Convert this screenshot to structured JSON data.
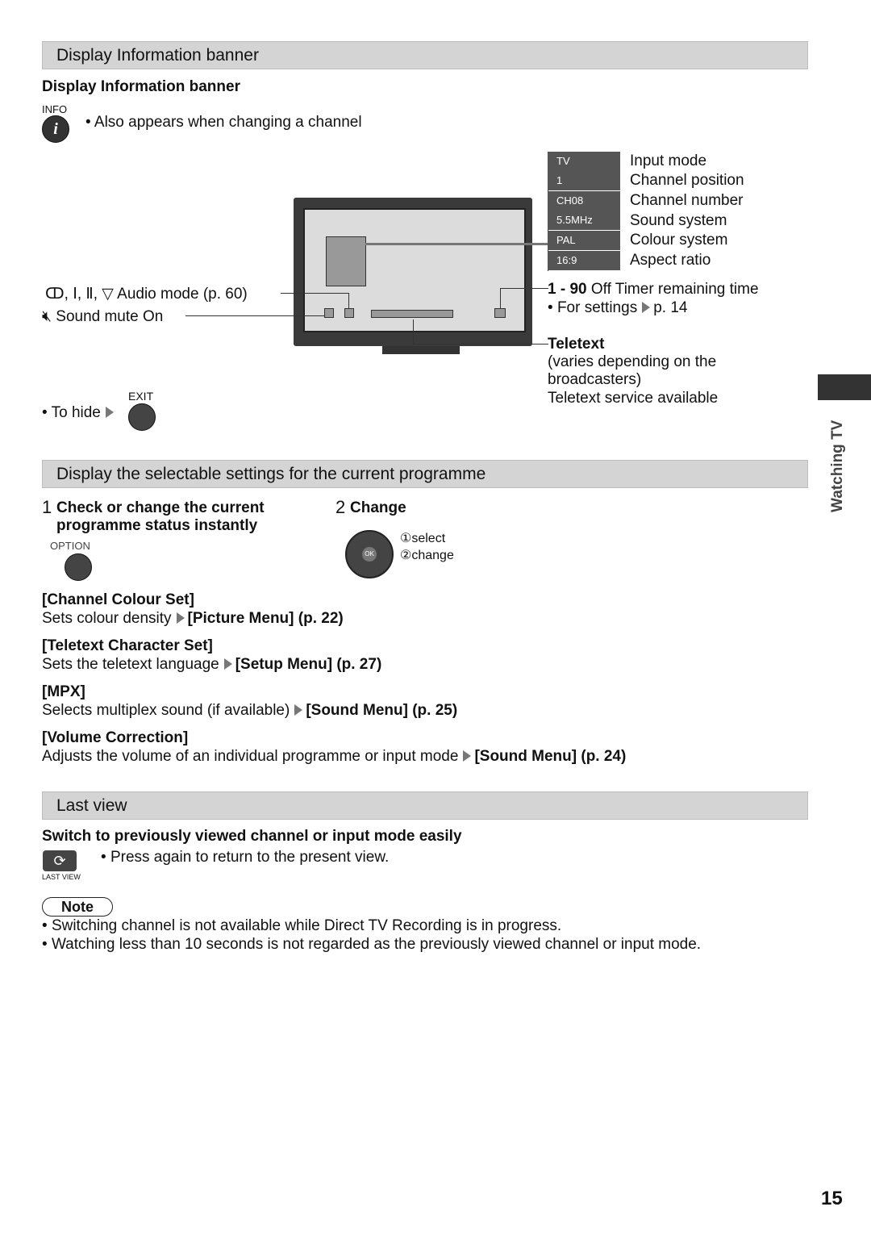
{
  "section1": {
    "title": "Display Information banner",
    "subtitle": "Display Information banner",
    "info_label": "INFO",
    "info_note": "Also appears when changing a channel",
    "osd": [
      {
        "code": "TV",
        "label": "Input mode"
      },
      {
        "code": "1",
        "label": "Channel position"
      },
      {
        "code": "CH08",
        "label": "Channel number"
      },
      {
        "code": "5.5MHz",
        "label": "Sound system"
      },
      {
        "code": "PAL",
        "label": "Colour system"
      },
      {
        "code": "16:9",
        "label": "Aspect ratio"
      }
    ],
    "audio_mode": "Audio mode (p. 60)",
    "audio_symbols": "ↀ, Ⅰ, Ⅱ, ▽",
    "sound_mute": "Sound mute On",
    "timer_range": "1 - 90",
    "timer_label": "Off Timer remaining time",
    "timer_settings": "For settings",
    "timer_page": "p. 14",
    "teletext_title": "Teletext",
    "teletext_line1": "(varies depending on the",
    "teletext_line2": "broadcasters)",
    "teletext_line3": "Teletext service available",
    "exit_label": "EXIT",
    "to_hide": "To hide"
  },
  "side_tab": "Watching TV",
  "section2": {
    "title": "Display the selectable settings for the current programme",
    "step1_num": "1",
    "step1_line1": "Check or change the current",
    "step1_line2": "programme status instantly",
    "option_label": "OPTION",
    "step2_num": "2",
    "step2": "Change",
    "ok_label": "OK",
    "select": "①select",
    "change": "②change",
    "items": [
      {
        "title": "[Channel Colour Set]",
        "desc": "Sets colour density",
        "ref": "[Picture Menu] (p. 22)"
      },
      {
        "title": "[Teletext Character Set]",
        "desc": "Sets the teletext language",
        "ref": "[Setup Menu] (p. 27)"
      },
      {
        "title": "[MPX]",
        "desc": "Selects multiplex sound (if available)",
        "ref": "[Sound Menu] (p. 25)"
      },
      {
        "title": "[Volume Correction]",
        "desc": "Adjusts the volume of an individual programme or input mode",
        "ref": "[Sound Menu] (p. 24)"
      }
    ]
  },
  "section3": {
    "title": "Last view",
    "subtitle": "Switch to previously viewed channel or input mode easily",
    "note": "Press again to return to the present view.",
    "button_label": "LAST VIEW"
  },
  "note": {
    "label": "Note",
    "items": [
      "Switching channel is not available while Direct TV Recording is in progress.",
      "Watching less than 10 seconds is not regarded as the previously viewed channel or input mode."
    ]
  },
  "page_number": "15"
}
